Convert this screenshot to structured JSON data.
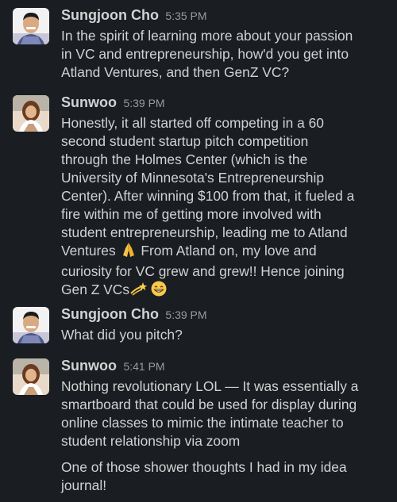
{
  "messages": [
    {
      "author": "Sungjoon Cho",
      "time": "5:35 PM",
      "avatar": "sungjoon-avatar",
      "paragraphs": [
        [
          "In the spirit of learning more about your passion",
          "in VC and entrepreneurship, how'd you get into",
          "Atland Ventures, and then GenZ VC?"
        ]
      ]
    },
    {
      "author": "Sunwoo",
      "time": "5:39 PM",
      "avatar": "sunwoo-avatar",
      "paragraphs": [
        [
          "Honestly, it all started off competing in a 60",
          "second student startup pitch competition",
          "through the Holmes Center (which is the",
          "University of Minnesota's Entrepreneurship",
          "Center). After winning $100 from that, it fueled a",
          "fire within me of getting more involved with",
          "student entrepreneurship, leading me to Atland"
        ],
        [
          "Ventures"
        ],
        [
          "From Atland on, my love and",
          "curiosity for VC grew and grew!! Hence joining"
        ],
        [
          "Gen Z VCs"
        ]
      ]
    },
    {
      "author": "Sungjoon Cho",
      "time": "5:39 PM",
      "avatar": "sungjoon-avatar",
      "paragraphs": [
        [
          "What did you pitch?"
        ]
      ]
    },
    {
      "author": "Sunwoo",
      "time": "5:41 PM",
      "avatar": "sunwoo-avatar",
      "paragraphs": [
        [
          "Nothing revolutionary LOL — It was essentially a",
          "smartboard that could be used for display during",
          "online classes to mimic the intimate teacher to",
          "student relationship via zoom"
        ],
        [
          "One of those shower thoughts I had in my idea",
          "journal!"
        ]
      ]
    }
  ],
  "emojis": {
    "pray": "folded-hands-emoji",
    "dizzy": "dizzy-emoji",
    "grin": "grinning-face-emoji"
  },
  "colors": {
    "background": "#1a1d21",
    "text": "#d1d2d3",
    "timestamp": "#9a9b9e"
  }
}
